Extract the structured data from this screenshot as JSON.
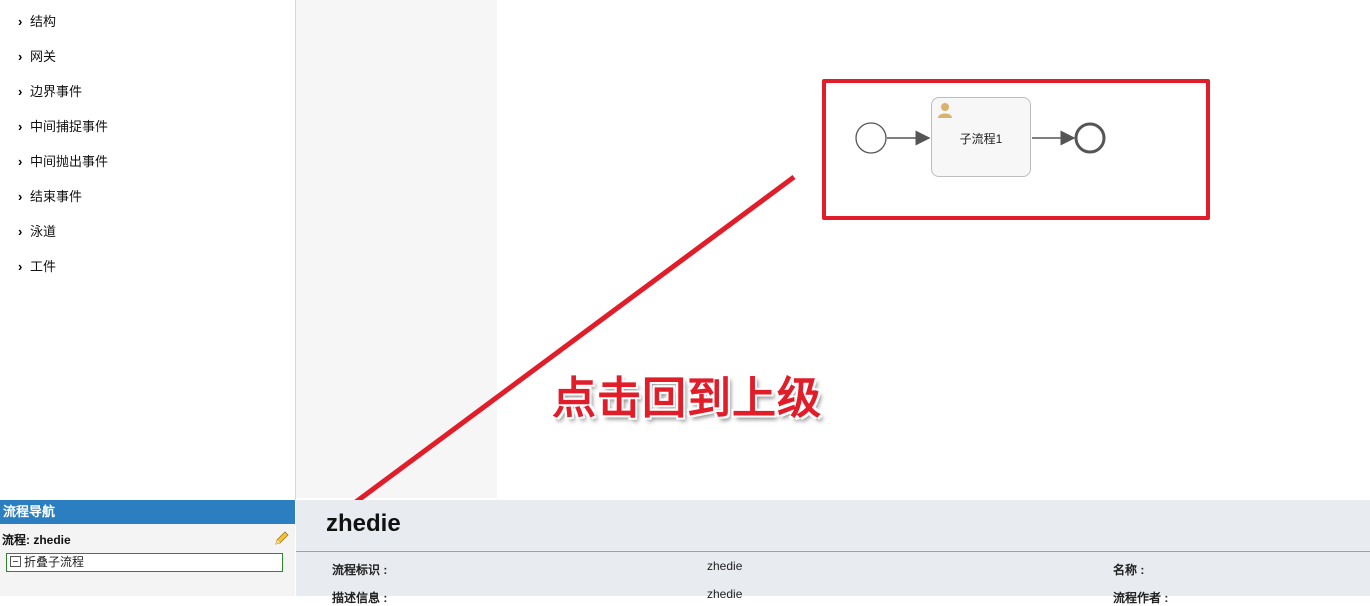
{
  "palette": {
    "items": [
      {
        "label": "结构"
      },
      {
        "label": "网关"
      },
      {
        "label": "边界事件"
      },
      {
        "label": "中间捕捉事件"
      },
      {
        "label": "中间抛出事件"
      },
      {
        "label": "结束事件"
      },
      {
        "label": "泳道"
      },
      {
        "label": "工件"
      }
    ]
  },
  "diagram": {
    "task_label": "子流程1",
    "annotation_color": "#e11d2a",
    "callout_text": "点击回到上级"
  },
  "nav": {
    "header": "流程导航",
    "process_label": "流程: zhedie",
    "subprocess_label": "折叠子流程"
  },
  "props": {
    "title": "zhedie",
    "fields": [
      {
        "label": "流程标识 :",
        "value": "zhedie"
      },
      {
        "label": "名称 :",
        "value": ""
      },
      {
        "label": "描述信息 :",
        "value": "zhedie"
      },
      {
        "label": "流程作者 :",
        "value": ""
      }
    ]
  },
  "colors": {
    "nav_header": "#2b7fc0",
    "props_bg": "#e8ecf1"
  }
}
